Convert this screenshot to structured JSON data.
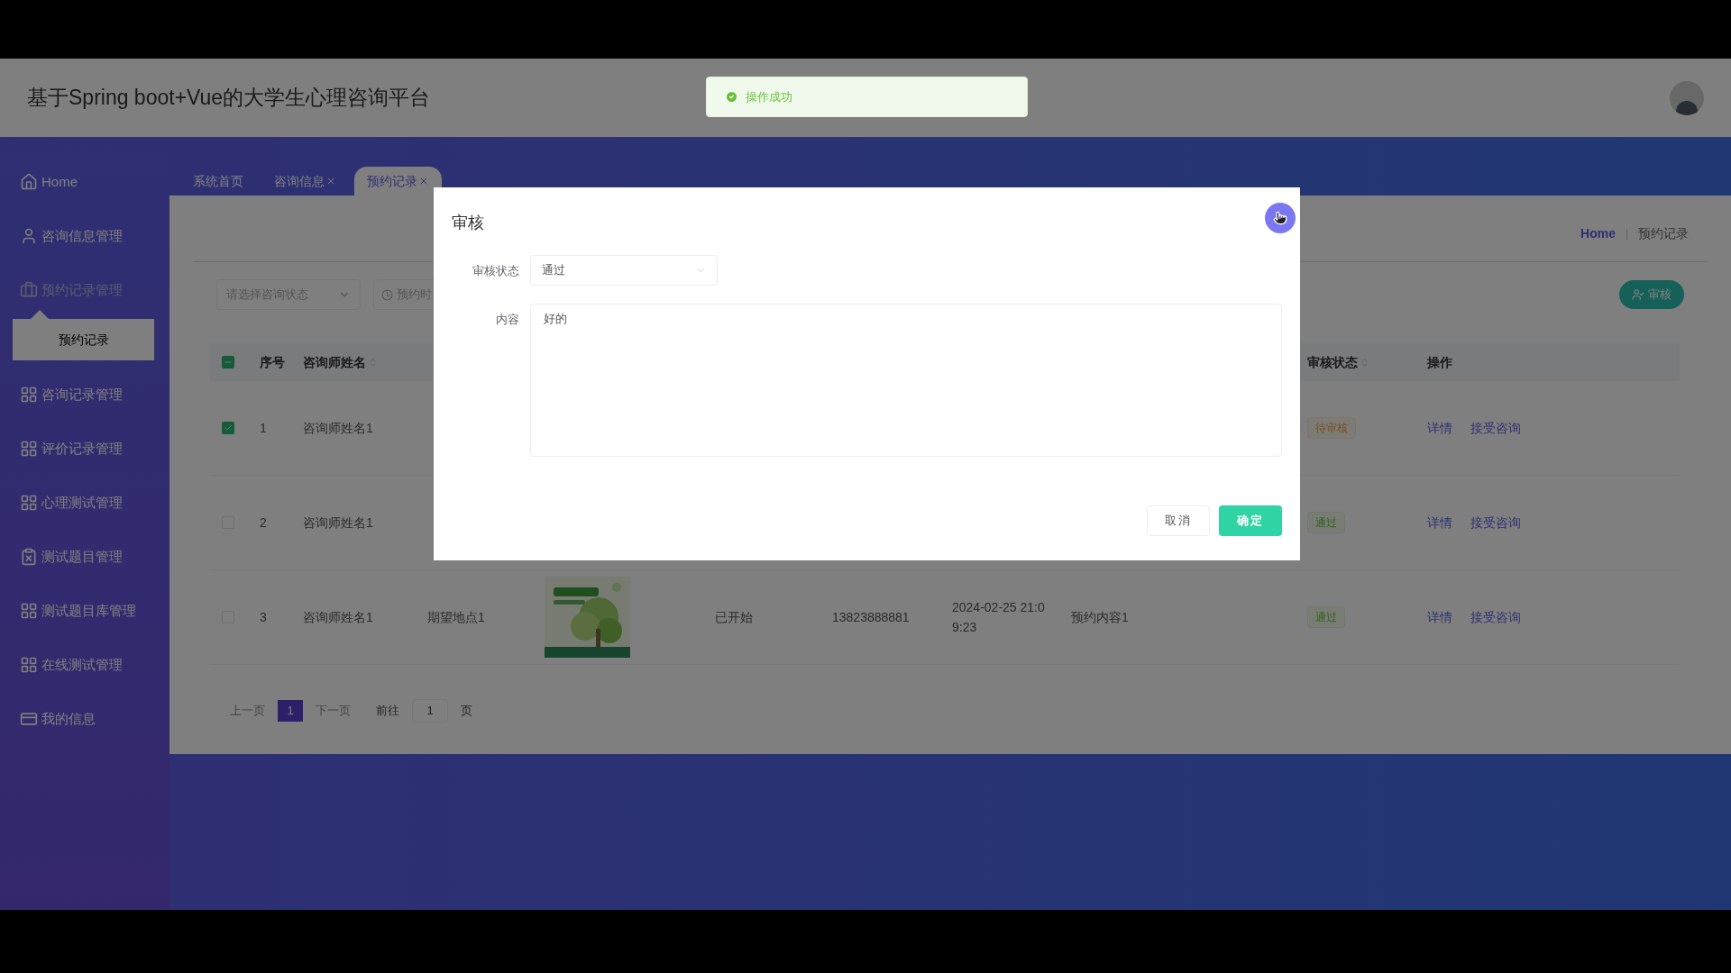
{
  "header": {
    "title": "基于Spring boot+Vue的大学生心理咨询平台"
  },
  "toast": {
    "message": "操作成功"
  },
  "sidebar": {
    "items": [
      {
        "label": "Home",
        "expanded": false
      },
      {
        "label": "咨询信息管理",
        "expanded": false
      },
      {
        "label": "预约记录管理",
        "expanded": true,
        "children": [
          {
            "label": "预约记录",
            "selected": true
          }
        ]
      },
      {
        "label": "咨询记录管理",
        "expanded": false
      },
      {
        "label": "评价记录管理",
        "expanded": false
      },
      {
        "label": "心理测试管理",
        "expanded": false
      },
      {
        "label": "测试题目管理",
        "expanded": false
      },
      {
        "label": "测试题目库管理",
        "expanded": false
      },
      {
        "label": "在线测试管理",
        "expanded": false
      },
      {
        "label": "我的信息",
        "expanded": false
      }
    ]
  },
  "tabs": [
    {
      "label": "系统首页",
      "closable": false,
      "selected": false
    },
    {
      "label": "咨询信息",
      "closable": true,
      "selected": false
    },
    {
      "label": "预约记录",
      "closable": true,
      "selected": true
    }
  ],
  "breadcrumb": [
    "Home",
    "预约记录"
  ],
  "toolbar": {
    "status_select": {
      "placeholder": "请选择咨询状态"
    },
    "date_field": {
      "placeholder": "预约时"
    },
    "review_button": "审核"
  },
  "table": {
    "select_all_indeterminate": true,
    "columns": [
      "序号",
      "咨询师姓名",
      "审核状态",
      "操作"
    ],
    "rows": [
      {
        "checked": true,
        "index": "1",
        "name": "咨询师姓名1",
        "review_status": {
          "text": "待审核",
          "kind": "pending"
        },
        "actions": [
          "详情",
          "接受咨询"
        ]
      },
      {
        "checked": false,
        "index": "2",
        "name": "咨询师姓名1",
        "review_status": {
          "text": "通过",
          "kind": "approved"
        },
        "actions": [
          "详情",
          "接受咨询"
        ]
      },
      {
        "checked": false,
        "index": "3",
        "name": "咨询师姓名1",
        "place": "期望地点1",
        "image": {
          "kind": "picture"
        },
        "state": "已开始",
        "phone": "13823888881",
        "time": "2024-02-25 21:09:23",
        "content": "预约内容1",
        "review_status": {
          "text": "通过",
          "kind": "approved"
        },
        "actions": [
          "详情",
          "接受咨询"
        ]
      }
    ]
  },
  "pagination": {
    "prev": "上一页",
    "pages": [
      {
        "label": "1",
        "selected": true
      }
    ],
    "next": "下一页",
    "goto": "前往",
    "goto_value": "1",
    "goto_suffix": "页"
  },
  "dialog": {
    "title": "审核",
    "fields": [
      {
        "label": "审核状态",
        "kind": "select",
        "value": "通过"
      },
      {
        "label": "内容",
        "kind": "textarea",
        "value": "好的"
      }
    ],
    "buttons": [
      {
        "label": "取消",
        "kind": "default"
      },
      {
        "label": "确定",
        "kind": "primary"
      }
    ]
  }
}
